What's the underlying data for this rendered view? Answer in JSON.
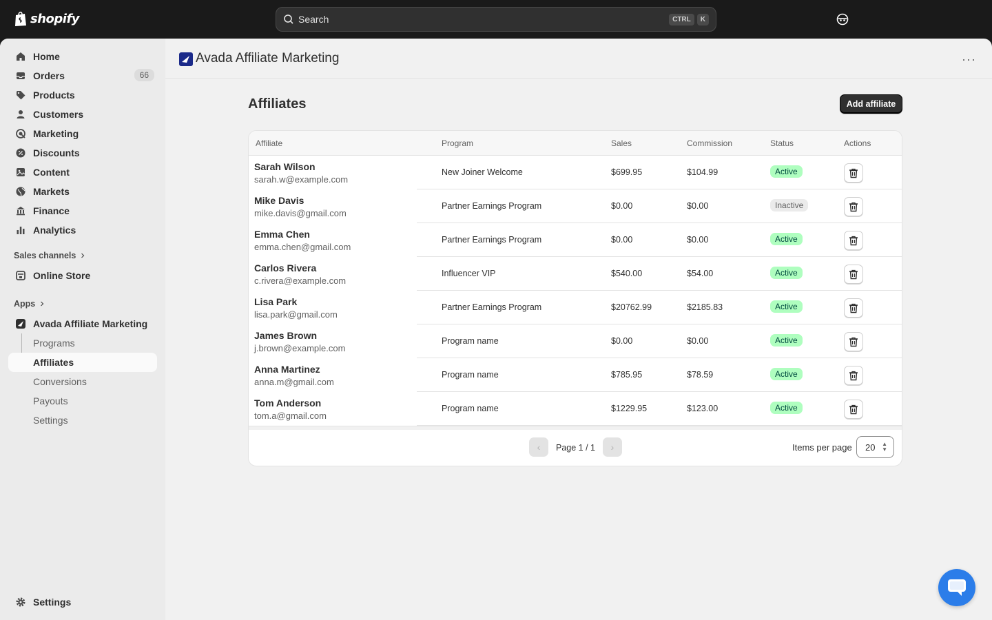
{
  "topbar": {
    "logo_text": "shopify",
    "search_placeholder": "Search",
    "shortcut_key1": "CTRL",
    "shortcut_key2": "K"
  },
  "sidebar": {
    "items": [
      {
        "label": "Home",
        "icon": "home-icon"
      },
      {
        "label": "Orders",
        "icon": "inbox-icon",
        "badge": "66"
      },
      {
        "label": "Products",
        "icon": "tag-icon"
      },
      {
        "label": "Customers",
        "icon": "person-icon"
      },
      {
        "label": "Marketing",
        "icon": "target-icon"
      },
      {
        "label": "Discounts",
        "icon": "discount-icon"
      },
      {
        "label": "Content",
        "icon": "content-icon"
      },
      {
        "label": "Markets",
        "icon": "globe-icon"
      },
      {
        "label": "Finance",
        "icon": "bank-icon"
      },
      {
        "label": "Analytics",
        "icon": "bar-chart-icon"
      }
    ],
    "sales_channels_label": "Sales channels",
    "online_store_label": "Online Store",
    "apps_label": "Apps",
    "app_name": "Avada Affiliate Marketing",
    "app_sub_items": [
      "Programs",
      "Affiliates",
      "Conversions",
      "Payouts",
      "Settings"
    ],
    "active_sub_item": "Affiliates",
    "settings_label": "Settings"
  },
  "app_header": {
    "title": "Avada Affiliate Marketing",
    "more_label": "···"
  },
  "page": {
    "title": "Affiliates",
    "add_button_label": "Add affiliate"
  },
  "table": {
    "headers": {
      "affiliate": "Affiliate",
      "program": "Program",
      "sales": "Sales",
      "commission": "Commission",
      "status": "Status",
      "actions": "Actions"
    },
    "rows": [
      {
        "name": "Sarah Wilson",
        "email": "sarah.w@example.com",
        "program": "New Joiner Welcome",
        "sales": "$699.95",
        "commission": "$104.99",
        "status": "Active"
      },
      {
        "name": "Mike Davis",
        "email": "mike.davis@gmail.com",
        "program": "Partner Earnings Program",
        "sales": "$0.00",
        "commission": "$0.00",
        "status": "Inactive"
      },
      {
        "name": "Emma Chen",
        "email": "emma.chen@gmail.com",
        "program": "Partner Earnings Program",
        "sales": "$0.00",
        "commission": "$0.00",
        "status": "Active"
      },
      {
        "name": "Carlos Rivera",
        "email": "c.rivera@example.com",
        "program": "Influencer VIP",
        "sales": "$540.00",
        "commission": "$54.00",
        "status": "Active"
      },
      {
        "name": "Lisa Park",
        "email": "lisa.park@gmail.com",
        "program": "Partner Earnings Program",
        "sales": "$20762.99",
        "commission": "$2185.83",
        "status": "Active"
      },
      {
        "name": "James Brown",
        "email": "j.brown@example.com",
        "program": "Program name",
        "sales": "$0.00",
        "commission": "$0.00",
        "status": "Active"
      },
      {
        "name": "Anna Martinez",
        "email": "anna.m@gmail.com",
        "program": "Program name",
        "sales": "$785.95",
        "commission": "$78.59",
        "status": "Active"
      },
      {
        "name": "Tom Anderson",
        "email": "tom.a@gmail.com",
        "program": "Program name",
        "sales": "$1229.95",
        "commission": "$123.00",
        "status": "Active"
      }
    ]
  },
  "pagination": {
    "page_text": "Page 1 / 1",
    "prev_label": "‹",
    "next_label": "›",
    "items_per_page_label": "Items per page",
    "items_per_page_value": "20"
  },
  "colors": {
    "active_badge_bg": "#affebf",
    "active_badge_text": "#014b40",
    "inactive_badge_bg": "#ebebeb",
    "chat_button": "#2b7de9"
  }
}
